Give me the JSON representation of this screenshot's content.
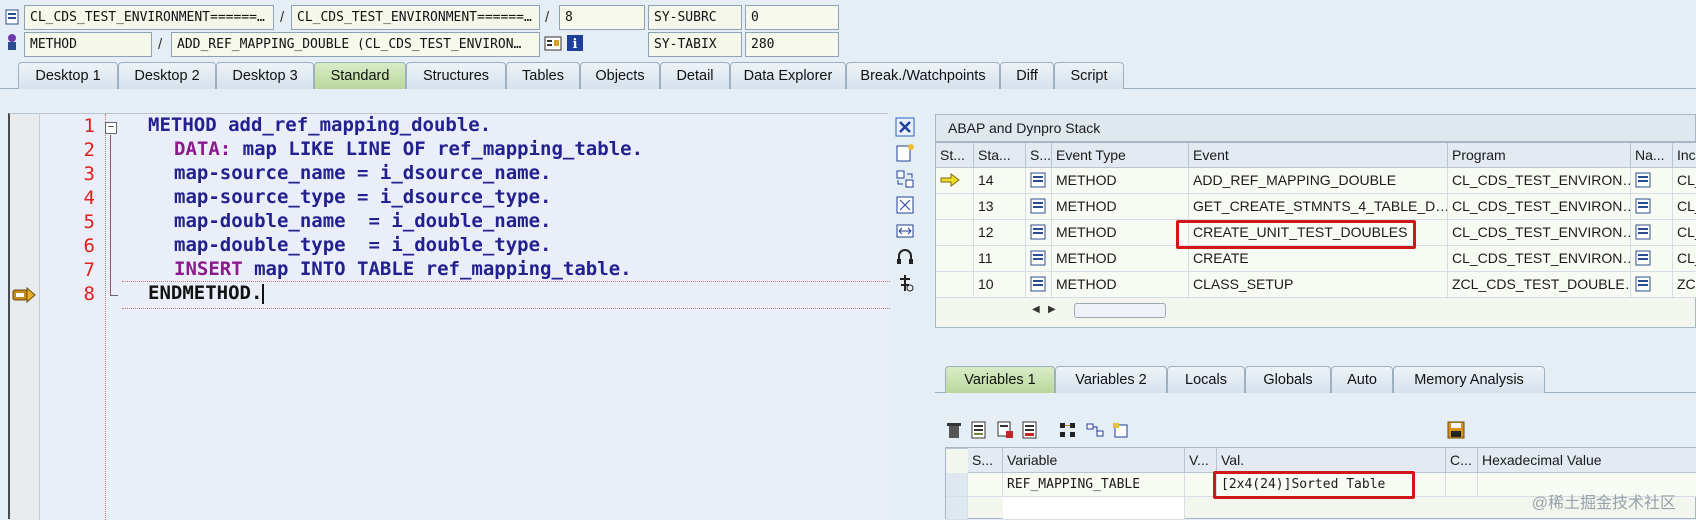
{
  "header": {
    "row1": {
      "field1": "CL_CDS_TEST_ENVIRONMENT======…",
      "field2": "CL_CDS_TEST_ENVIRONMENT======…",
      "line": "8",
      "sysvar": "SY-SUBRC",
      "sysval": "0"
    },
    "row2": {
      "type": "METHOD",
      "name": "ADD_REF_MAPPING_DOUBLE (CL_CDS_TEST_ENVIRON…",
      "sysvar": "SY-TABIX",
      "sysval": "280"
    }
  },
  "tabs": [
    "Desktop 1",
    "Desktop 2",
    "Desktop 3",
    "Standard",
    "Structures",
    "Tables",
    "Objects",
    "Detail",
    "Data Explorer",
    "Break./Watchpoints",
    "Diff",
    "Script"
  ],
  "active_tab": "Standard",
  "code": {
    "line_numbers": [
      "1",
      "2",
      "3",
      "4",
      "5",
      "6",
      "7",
      "8"
    ],
    "lines": [
      {
        "kw": "METHOD",
        "rest": " add_ref_mapping_double."
      },
      {
        "kw": "DATA:",
        "rest": " map LIKE LINE OF ref_mapping_table."
      },
      {
        "kw": "",
        "rest": "map-source_name = i_dsource_name."
      },
      {
        "kw": "",
        "rest": "map-source_type = i_dsource_type."
      },
      {
        "kw": "",
        "rest": "map-double_name  = i_double_name."
      },
      {
        "kw": "",
        "rest": "map-double_type  = i_double_type."
      },
      {
        "kw": "INSERT",
        "rest": " map INTO TABLE ref_mapping_table."
      },
      {
        "kw": "",
        "rest": "ENDMETHOD."
      }
    ]
  },
  "stack": {
    "title": "ABAP and Dynpro Stack",
    "columns": [
      "St...",
      "Sta...",
      "S...",
      "Event Type",
      "Event",
      "Program",
      "Na...",
      "Incl"
    ],
    "rows": [
      {
        "level": "14",
        "type": "METHOD",
        "event": "ADD_REF_MAPPING_DOUBLE",
        "program": "CL_CDS_TEST_ENVIRON…",
        "incl": "CL_"
      },
      {
        "level": "13",
        "type": "METHOD",
        "event": "GET_CREATE_STMNTS_4_TABLE_D…",
        "program": "CL_CDS_TEST_ENVIRON…",
        "incl": "CL_"
      },
      {
        "level": "12",
        "type": "METHOD",
        "event": "CREATE_UNIT_TEST_DOUBLES",
        "program": "CL_CDS_TEST_ENVIRON…",
        "incl": "CL_"
      },
      {
        "level": "11",
        "type": "METHOD",
        "event": "CREATE",
        "program": "CL_CDS_TEST_ENVIRON…",
        "incl": "CL_"
      },
      {
        "level": "10",
        "type": "METHOD",
        "event": "CLASS_SETUP",
        "program": "ZCL_CDS_TEST_DOUBLE…",
        "incl": "ZCL"
      }
    ]
  },
  "var_tabs": [
    "Variables 1",
    "Variables 2",
    "Locals",
    "Globals",
    "Auto",
    "Memory Analysis"
  ],
  "var_active": "Variables 1",
  "vars": {
    "columns": [
      "S...",
      "Variable",
      "V...",
      "Val.",
      "C...",
      "Hexadecimal Value"
    ],
    "rows": [
      {
        "variable": "REF_MAPPING_TABLE",
        "value": "[2x4(24)]Sorted Table"
      }
    ]
  },
  "watermark": "@稀土掘金技术社区"
}
